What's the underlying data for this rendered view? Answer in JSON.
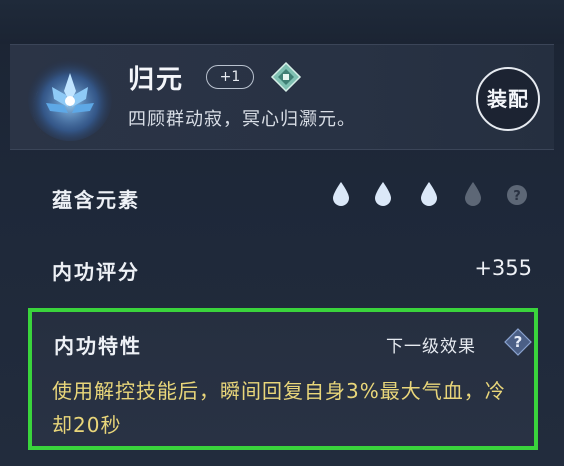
{
  "header": {
    "title": "归元",
    "level_badge": "+1",
    "description": "四顾群动寂，冥心归灏元。",
    "equip_label": "装配"
  },
  "elements": {
    "label": "蕴含元素",
    "filled": 3,
    "total": 4,
    "unknown_glyph": "?"
  },
  "score": {
    "label": "内功评分",
    "value": "+355"
  },
  "trait": {
    "title": "内功特性",
    "next_level_label": "下一级效果",
    "help_glyph": "?",
    "description": "使用解控技能后，瞬间回复自身3%最大气血，冷却20秒"
  },
  "colors": {
    "highlight_border": "#3ad43c",
    "trait_text": "#e9d67a",
    "drop_active": "#dbe8f8",
    "drop_inactive": "#5d6776"
  }
}
